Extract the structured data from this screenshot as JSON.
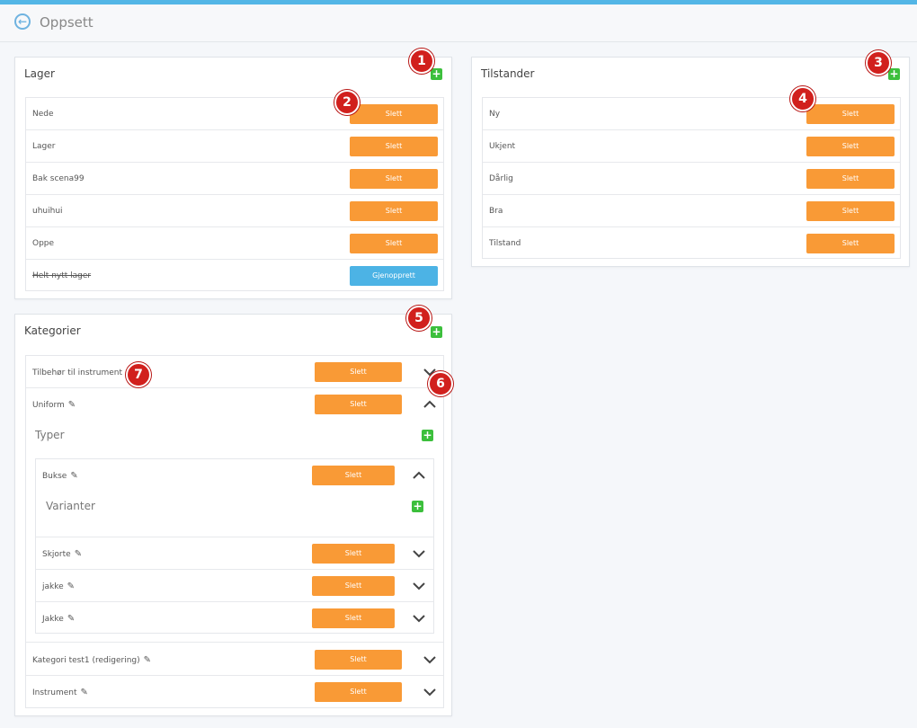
{
  "header": {
    "title": "Oppsett",
    "back_icon": "arrow-left-circle-icon"
  },
  "lager": {
    "title": "Lager",
    "items": [
      {
        "label": "Nede",
        "action": "Slett",
        "deleted": false
      },
      {
        "label": "Lager",
        "action": "Slett",
        "deleted": false
      },
      {
        "label": "Bak scena99",
        "action": "Slett",
        "deleted": false
      },
      {
        "label": "uhuihui",
        "action": "Slett",
        "deleted": false
      },
      {
        "label": "Oppe",
        "action": "Slett",
        "deleted": false
      },
      {
        "label": "Helt nytt lager",
        "action": "Gjenopprett",
        "deleted": true
      }
    ]
  },
  "tilstander": {
    "title": "Tilstander",
    "items": [
      {
        "label": "Ny",
        "action": "Slett"
      },
      {
        "label": "Ukjent",
        "action": "Slett"
      },
      {
        "label": "Dårlig",
        "action": "Slett"
      },
      {
        "label": "Bra",
        "action": "Slett"
      },
      {
        "label": "Tilstand",
        "action": "Slett"
      }
    ]
  },
  "kategorier": {
    "title": "Kategorier",
    "items": [
      {
        "label": "Tilbehør til instrument",
        "action": "Slett",
        "expanded": false
      },
      {
        "label": "Uniform",
        "action": "Slett",
        "expanded": true
      },
      {
        "label": "Kategori test1 (redigering)",
        "action": "Slett",
        "expanded": false
      },
      {
        "label": "Instrument",
        "action": "Slett",
        "expanded": false
      }
    ],
    "typer": {
      "title": "Typer",
      "items": [
        {
          "label": "Bukse",
          "action": "Slett",
          "expanded": true
        },
        {
          "label": "Skjorte",
          "action": "Slett",
          "expanded": false
        },
        {
          "label": "jakke",
          "action": "Slett",
          "expanded": false
        },
        {
          "label": "Jakke",
          "action": "Slett",
          "expanded": false
        }
      ],
      "varianter": {
        "title": "Varianter"
      }
    }
  },
  "annotations": [
    "1",
    "2",
    "3",
    "4",
    "5",
    "6",
    "7"
  ],
  "colors": {
    "accent": "#53b6e6",
    "delete": "#f99a36",
    "restore": "#4cb3e5",
    "add": "#3cbf3c",
    "badge": "#d1201d"
  }
}
